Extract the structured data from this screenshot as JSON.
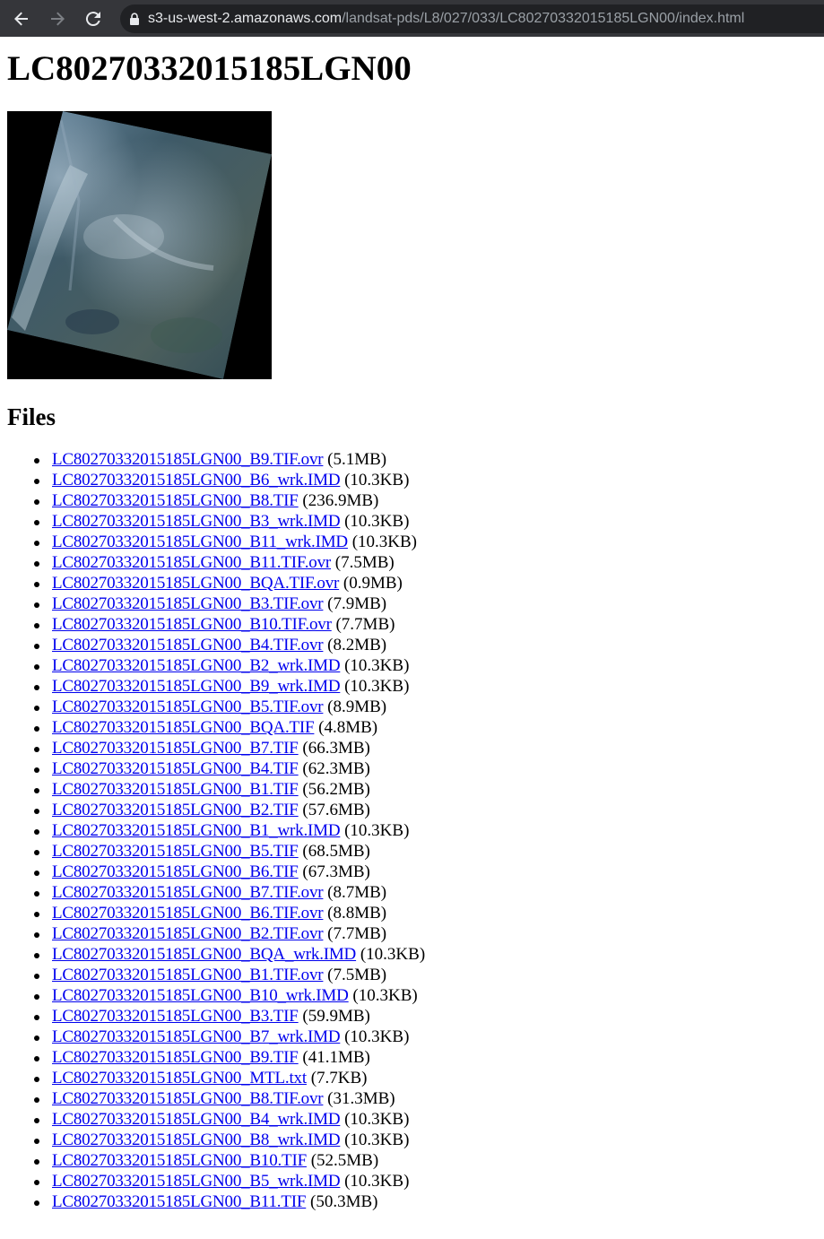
{
  "browser": {
    "url_host": "s3-us-west-2.amazonaws.com",
    "url_path": "/landsat-pds/L8/027/033/LC80270332015185LGN00/index.html",
    "icons": {
      "back": "arrow-left-icon",
      "forward": "arrow-right-icon",
      "reload": "reload-icon",
      "secure": "lock-icon"
    },
    "colors": {
      "toolbar": "#35363a",
      "omnibox": "#202124",
      "host_text": "#e8eaed",
      "path_text": "#9aa0a6"
    }
  },
  "page": {
    "title": "LC80270332015185LGN00",
    "files_heading": "Files",
    "link_color": "#0000ee"
  },
  "files": [
    {
      "name": "LC80270332015185LGN00_B9.TIF.ovr",
      "size": "(5.1MB)"
    },
    {
      "name": "LC80270332015185LGN00_B6_wrk.IMD",
      "size": "(10.3KB)"
    },
    {
      "name": "LC80270332015185LGN00_B8.TIF",
      "size": "(236.9MB)"
    },
    {
      "name": "LC80270332015185LGN00_B3_wrk.IMD",
      "size": "(10.3KB)"
    },
    {
      "name": "LC80270332015185LGN00_B11_wrk.IMD",
      "size": "(10.3KB)"
    },
    {
      "name": "LC80270332015185LGN00_B11.TIF.ovr",
      "size": "(7.5MB)"
    },
    {
      "name": "LC80270332015185LGN00_BQA.TIF.ovr",
      "size": "(0.9MB)"
    },
    {
      "name": "LC80270332015185LGN00_B3.TIF.ovr",
      "size": "(7.9MB)"
    },
    {
      "name": "LC80270332015185LGN00_B10.TIF.ovr",
      "size": "(7.7MB)"
    },
    {
      "name": "LC80270332015185LGN00_B4.TIF.ovr",
      "size": "(8.2MB)"
    },
    {
      "name": "LC80270332015185LGN00_B2_wrk.IMD",
      "size": "(10.3KB)"
    },
    {
      "name": "LC80270332015185LGN00_B9_wrk.IMD",
      "size": "(10.3KB)"
    },
    {
      "name": "LC80270332015185LGN00_B5.TIF.ovr",
      "size": "(8.9MB)"
    },
    {
      "name": "LC80270332015185LGN00_BQA.TIF",
      "size": "(4.8MB)"
    },
    {
      "name": "LC80270332015185LGN00_B7.TIF",
      "size": "(66.3MB)"
    },
    {
      "name": "LC80270332015185LGN00_B4.TIF",
      "size": "(62.3MB)"
    },
    {
      "name": "LC80270332015185LGN00_B1.TIF",
      "size": "(56.2MB)"
    },
    {
      "name": "LC80270332015185LGN00_B2.TIF",
      "size": "(57.6MB)"
    },
    {
      "name": "LC80270332015185LGN00_B1_wrk.IMD",
      "size": "(10.3KB)"
    },
    {
      "name": "LC80270332015185LGN00_B5.TIF",
      "size": "(68.5MB)"
    },
    {
      "name": "LC80270332015185LGN00_B6.TIF",
      "size": "(67.3MB)"
    },
    {
      "name": "LC80270332015185LGN00_B7.TIF.ovr",
      "size": "(8.7MB)"
    },
    {
      "name": "LC80270332015185LGN00_B6.TIF.ovr",
      "size": "(8.8MB)"
    },
    {
      "name": "LC80270332015185LGN00_B2.TIF.ovr",
      "size": "(7.7MB)"
    },
    {
      "name": "LC80270332015185LGN00_BQA_wrk.IMD",
      "size": "(10.3KB)"
    },
    {
      "name": "LC80270332015185LGN00_B1.TIF.ovr",
      "size": "(7.5MB)"
    },
    {
      "name": "LC80270332015185LGN00_B10_wrk.IMD",
      "size": "(10.3KB)"
    },
    {
      "name": "LC80270332015185LGN00_B3.TIF",
      "size": "(59.9MB)"
    },
    {
      "name": "LC80270332015185LGN00_B7_wrk.IMD",
      "size": "(10.3KB)"
    },
    {
      "name": "LC80270332015185LGN00_B9.TIF",
      "size": "(41.1MB)"
    },
    {
      "name": "LC80270332015185LGN00_MTL.txt",
      "size": "(7.7KB)"
    },
    {
      "name": "LC80270332015185LGN00_B8.TIF.ovr",
      "size": "(31.3MB)"
    },
    {
      "name": "LC80270332015185LGN00_B4_wrk.IMD",
      "size": "(10.3KB)"
    },
    {
      "name": "LC80270332015185LGN00_B8_wrk.IMD",
      "size": "(10.3KB)"
    },
    {
      "name": "LC80270332015185LGN00_B10.TIF",
      "size": "(52.5MB)"
    },
    {
      "name": "LC80270332015185LGN00_B5_wrk.IMD",
      "size": "(10.3KB)"
    },
    {
      "name": "LC80270332015185LGN00_B11.TIF",
      "size": "(50.3MB)"
    }
  ]
}
